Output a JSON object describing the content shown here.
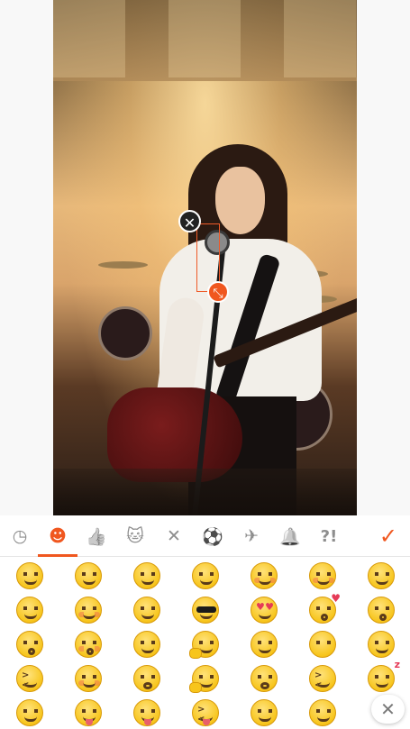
{
  "overlay": {
    "close_glyph": "✕",
    "resize_glyph": "⤡"
  },
  "categories": {
    "items": [
      {
        "name": "recent-icon",
        "glyph": "◷"
      },
      {
        "name": "smiley-icon",
        "glyph": "☻"
      },
      {
        "name": "thumbs-up-icon",
        "glyph": "👍"
      },
      {
        "name": "cat-icon",
        "glyph": "🐱"
      },
      {
        "name": "utensils-icon",
        "glyph": "✕"
      },
      {
        "name": "ball-icon",
        "glyph": "⚽"
      },
      {
        "name": "airplane-icon",
        "glyph": "✈"
      },
      {
        "name": "bell-icon",
        "glyph": "🔔"
      },
      {
        "name": "symbols-icon",
        "glyph": "?!"
      }
    ],
    "active_index": 1,
    "confirm_glyph": "✓"
  },
  "emoji_grid": {
    "columns": 7,
    "rows": 5,
    "close_glyph": "✕"
  },
  "colors": {
    "accent": "#f0571f",
    "icon_gray": "#8e8e8e"
  }
}
